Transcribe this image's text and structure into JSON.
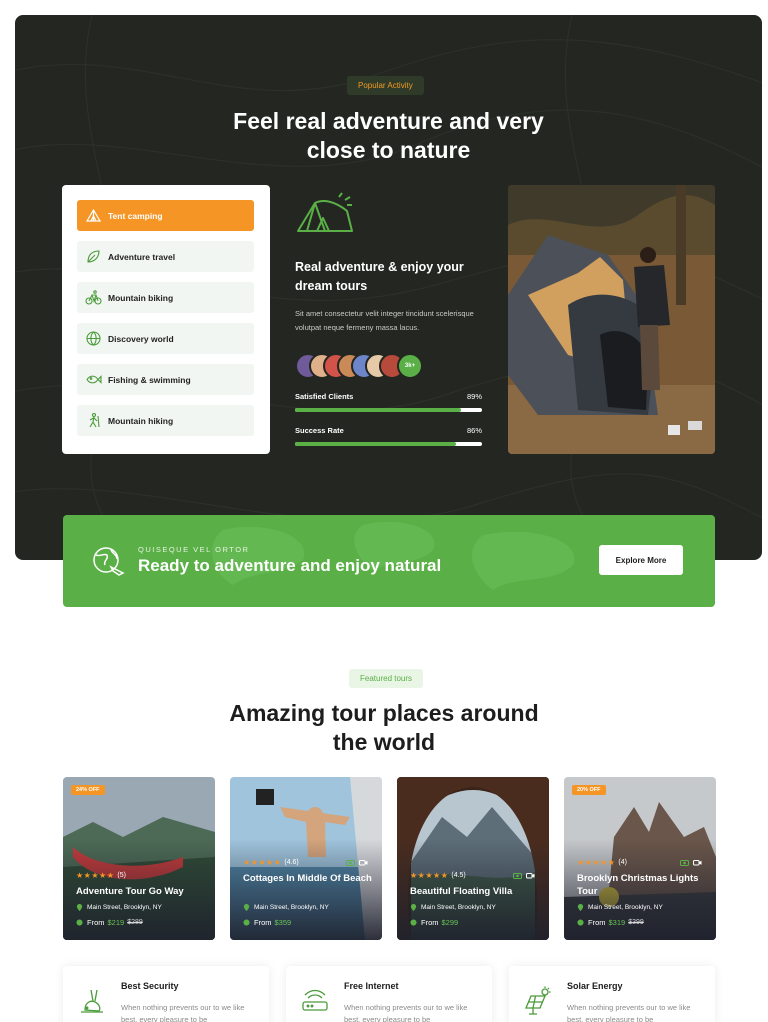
{
  "colors": {
    "hero_bg": "#232621",
    "accent_orange": "#f59526",
    "accent_green": "#5ab047"
  },
  "hero": {
    "pill": "Popular Activity",
    "title_line1": "Feel real adventure and very",
    "title_line2": "close to nature"
  },
  "activities": [
    {
      "label": "Tent camping",
      "icon": "tent-icon",
      "active": true
    },
    {
      "label": "Adventure travel",
      "icon": "leaf-icon",
      "active": false
    },
    {
      "label": "Mountain biking",
      "icon": "bike-icon",
      "active": false
    },
    {
      "label": "Discovery world",
      "icon": "globe-icon",
      "active": false
    },
    {
      "label": "Fishing & swimming",
      "icon": "fish-icon",
      "active": false
    },
    {
      "label": "Mountain hiking",
      "icon": "hiker-icon",
      "active": false
    }
  ],
  "detail": {
    "title": "Real adventure & enjoy your dream tours",
    "text": "Sit amet consectetur velit integer tincidunt scelerisque volutpat neque fermeny massa lacus.",
    "avatar_count": "3k+",
    "stats": [
      {
        "label": "Satisfied Clients",
        "value": "89%",
        "fraction": 0.89
      },
      {
        "label": "Success Rate",
        "value": "86%",
        "fraction": 0.86
      }
    ]
  },
  "cta": {
    "kicker": "QUISEQUE VEL ORTOR",
    "title": "Ready to adventure and enjoy natural",
    "button": "Explore More"
  },
  "featured": {
    "pill": "Featured tours",
    "title_line1": "Amazing tour places around",
    "title_line2": "the world"
  },
  "tours": [
    {
      "badge": "24% OFF",
      "rating": "(5)",
      "stars": 5,
      "title": "Adventure Tour Go Way",
      "location": "Main Street, Brooklyn, NY",
      "from": "From",
      "price": "$219",
      "old_price": "$289"
    },
    {
      "badge": "",
      "rating": "(4.6)",
      "stars": 5,
      "title": "Cottages In Middle Of Beach",
      "location": "Main Street, Brooklyn, NY",
      "from": "From",
      "price": "$359",
      "old_price": ""
    },
    {
      "badge": "",
      "rating": "(4.5)",
      "stars": 5,
      "title": "Beautiful Floating Villa",
      "location": "Main Street, Brooklyn, NY",
      "from": "From",
      "price": "$299",
      "old_price": ""
    },
    {
      "badge": "20% OFF",
      "rating": "(4)",
      "stars": 5,
      "title": "Brooklyn Christmas Lights Tour",
      "location": "Main Street, Brooklyn, NY",
      "from": "From",
      "price": "$319",
      "old_price": "$399"
    }
  ],
  "features": [
    {
      "title": "Best Security",
      "text": "When nothing prevents our to we like best, every pleasure to be",
      "icon": "rabbit-icon"
    },
    {
      "title": "Free Internet",
      "text": "When nothing prevents our to we like best, every pleasure to be",
      "icon": "router-icon"
    },
    {
      "title": "Solar Energy",
      "text": "When nothing prevents our to we like best, every pleasure to be",
      "icon": "solar-panel-icon"
    }
  ]
}
